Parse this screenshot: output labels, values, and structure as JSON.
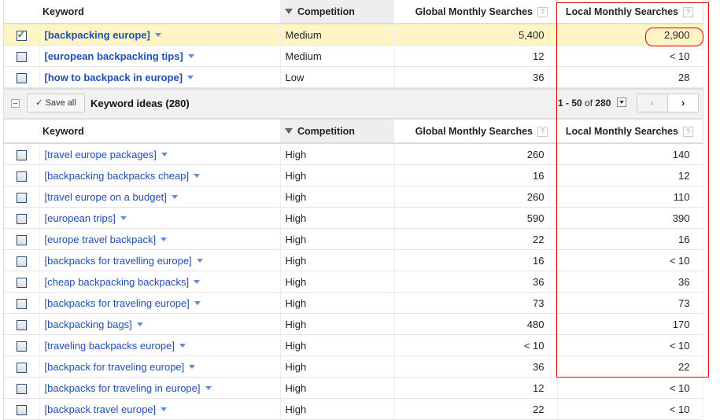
{
  "columns": {
    "keyword": "Keyword",
    "competition": "Competition",
    "global": "Global Monthly Searches",
    "local": "Local Monthly Searches",
    "help": "?"
  },
  "search_terms": [
    {
      "keyword": "[backpacking europe]",
      "competition": "Medium",
      "global": "5,400",
      "local": "2,900",
      "checked": true
    },
    {
      "keyword": "[european backpacking tips]",
      "competition": "Medium",
      "global": "12",
      "local": "< 10",
      "checked": false
    },
    {
      "keyword": "[how to backpack in europe]",
      "competition": "Low",
      "global": "36",
      "local": "28",
      "checked": false
    }
  ],
  "ideas_bar": {
    "save_all": "Save all",
    "title": "Keyword ideas (280)",
    "range": "1 - 50",
    "of": "of",
    "total": "280",
    "prev": "‹",
    "next": "›"
  },
  "keyword_ideas": [
    {
      "keyword": "[travel europe packages]",
      "competition": "High",
      "global": "260",
      "local": "140"
    },
    {
      "keyword": "[backpacking backpacks cheap]",
      "competition": "High",
      "global": "16",
      "local": "12"
    },
    {
      "keyword": "[travel europe on a budget]",
      "competition": "High",
      "global": "260",
      "local": "110"
    },
    {
      "keyword": "[european trips]",
      "competition": "High",
      "global": "590",
      "local": "390"
    },
    {
      "keyword": "[europe travel backpack]",
      "competition": "High",
      "global": "22",
      "local": "16"
    },
    {
      "keyword": "[backpacks for travelling europe]",
      "competition": "High",
      "global": "16",
      "local": "< 10"
    },
    {
      "keyword": "[cheap backpacking backpacks]",
      "competition": "High",
      "global": "36",
      "local": "36"
    },
    {
      "keyword": "[backpacks for traveling europe]",
      "competition": "High",
      "global": "73",
      "local": "73"
    },
    {
      "keyword": "[backpacking bags]",
      "competition": "High",
      "global": "480",
      "local": "170"
    },
    {
      "keyword": "[traveling backpacks europe]",
      "competition": "High",
      "global": "< 10",
      "local": "< 10"
    },
    {
      "keyword": "[backpack for traveling europe]",
      "competition": "High",
      "global": "36",
      "local": "22"
    },
    {
      "keyword": "[backpacks for traveling in europe]",
      "competition": "High",
      "global": "12",
      "local": "< 10"
    },
    {
      "keyword": "[backpack travel europe]",
      "competition": "High",
      "global": "22",
      "local": "< 10"
    }
  ]
}
